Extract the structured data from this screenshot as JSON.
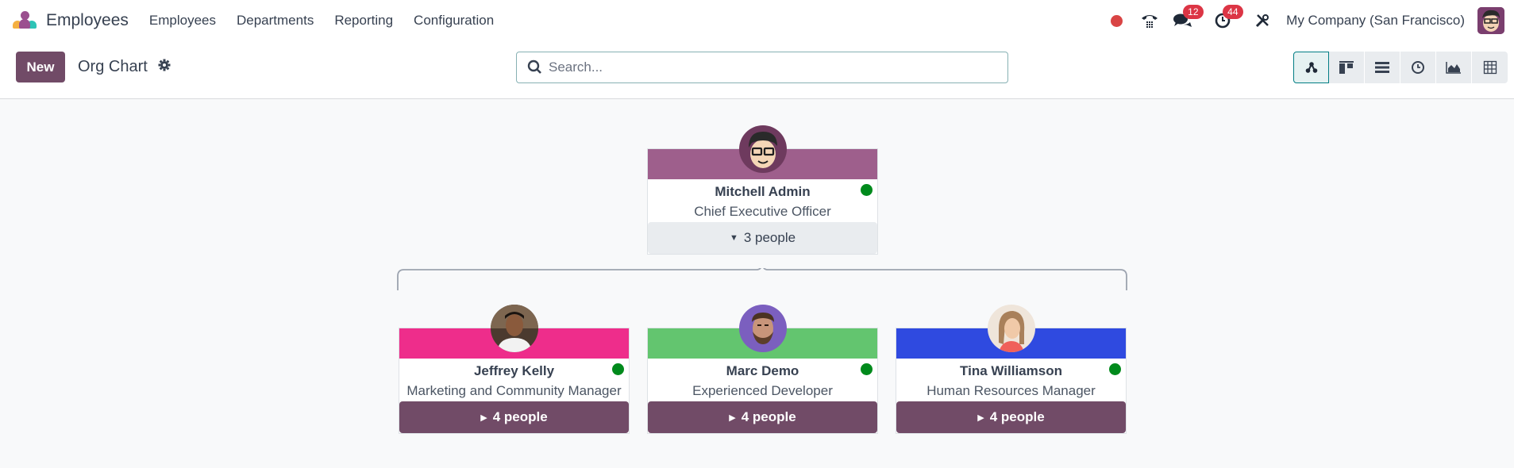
{
  "navbar": {
    "app_name": "Employees",
    "menu": [
      "Employees",
      "Departments",
      "Reporting",
      "Configuration"
    ],
    "systray": {
      "recording_icon": "red-dot",
      "phone_icon": "phone-icon",
      "messages_count": "12",
      "activities_count": "44",
      "tools_icon": "tools-icon",
      "company": "My Company (San Francisco)"
    }
  },
  "control_panel": {
    "new_label": "New",
    "view_title": "Org Chart",
    "search_placeholder": "Search...",
    "search_value": "",
    "views": [
      "hierarchy",
      "kanban",
      "list",
      "activity",
      "graph",
      "pivot"
    ],
    "active_view": "hierarchy"
  },
  "org_chart": {
    "root": {
      "name": "Mitchell Admin",
      "job": "Chief Executive Officer",
      "color": "#9e5f8c",
      "status": "online",
      "people_label": "3 people",
      "expanded": true
    },
    "children": [
      {
        "name": "Jeffrey Kelly",
        "job": "Marketing and Community Manager",
        "color": "#ee2d8b",
        "status": "online",
        "people_label": "4 people",
        "expanded": false
      },
      {
        "name": "Marc Demo",
        "job": "Experienced Developer",
        "color": "#63c56f",
        "status": "online",
        "people_label": "4 people",
        "expanded": false
      },
      {
        "name": "Tina Williamson",
        "job": "Human Resources Manager",
        "color": "#2f4ae0",
        "status": "online",
        "people_label": "4 people",
        "expanded": false
      }
    ]
  }
}
